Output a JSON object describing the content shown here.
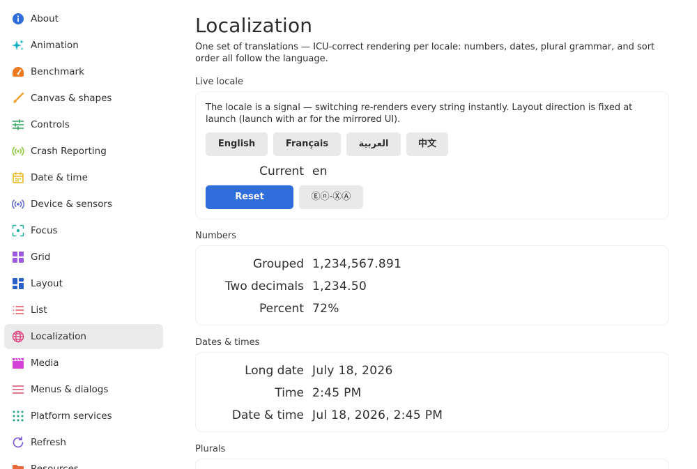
{
  "sidebar": {
    "items": [
      {
        "label": "About",
        "icon": "info-icon"
      },
      {
        "label": "Animation",
        "icon": "sparkle-icon"
      },
      {
        "label": "Benchmark",
        "icon": "speedometer-icon"
      },
      {
        "label": "Canvas & shapes",
        "icon": "brush-icon"
      },
      {
        "label": "Controls",
        "icon": "sliders-icon"
      },
      {
        "label": "Crash Reporting",
        "icon": "broadcast-icon"
      },
      {
        "label": "Date & time",
        "icon": "calendar-icon"
      },
      {
        "label": "Device & sensors",
        "icon": "sensor-icon"
      },
      {
        "label": "Focus",
        "icon": "focus-icon"
      },
      {
        "label": "Grid",
        "icon": "grid-icon"
      },
      {
        "label": "Layout",
        "icon": "layout-icon"
      },
      {
        "label": "List",
        "icon": "list-icon"
      },
      {
        "label": "Localization",
        "icon": "globe-icon",
        "active": true
      },
      {
        "label": "Media",
        "icon": "clapperboard-icon"
      },
      {
        "label": "Menus & dialogs",
        "icon": "menu-icon"
      },
      {
        "label": "Platform services",
        "icon": "dots-grid-icon"
      },
      {
        "label": "Refresh",
        "icon": "refresh-icon"
      },
      {
        "label": "Resources",
        "icon": "folder-icon"
      }
    ]
  },
  "main": {
    "title": "Localization",
    "subtitle": "One set of translations — ICU-correct rendering per locale: numbers, dates, plural grammar, and sort order all follow the language.",
    "live_locale": {
      "section_label": "Live locale",
      "description": "The locale is a signal — switching re-renders every string instantly. Layout direction is fixed at launch (launch with ar for the mirrored UI).",
      "languages": [
        "English",
        "Français",
        "العربية",
        "中文"
      ],
      "current_label": "Current",
      "current_value": "en",
      "reset_label": "Reset",
      "pseudo_label": "Ⓔⓝ-ⓍⒶ"
    },
    "numbers": {
      "section_label": "Numbers",
      "rows": [
        {
          "key": "Grouped",
          "value": "1,234,567.891"
        },
        {
          "key": "Two decimals",
          "value": "1,234.50"
        },
        {
          "key": "Percent",
          "value": "72%"
        }
      ]
    },
    "dates": {
      "section_label": "Dates & times",
      "rows": [
        {
          "key": "Long date",
          "value": "July 18, 2026"
        },
        {
          "key": "Time",
          "value": "2:45 PM"
        },
        {
          "key": "Date & time",
          "value": "Jul 18, 2026, 2:45 PM"
        }
      ]
    },
    "plurals": {
      "section_label": "Plurals"
    }
  },
  "colors": {
    "accent": "#2f6ddb",
    "active_nav_bg": "#eaeaea",
    "button_bg": "#e9e9e9"
  }
}
